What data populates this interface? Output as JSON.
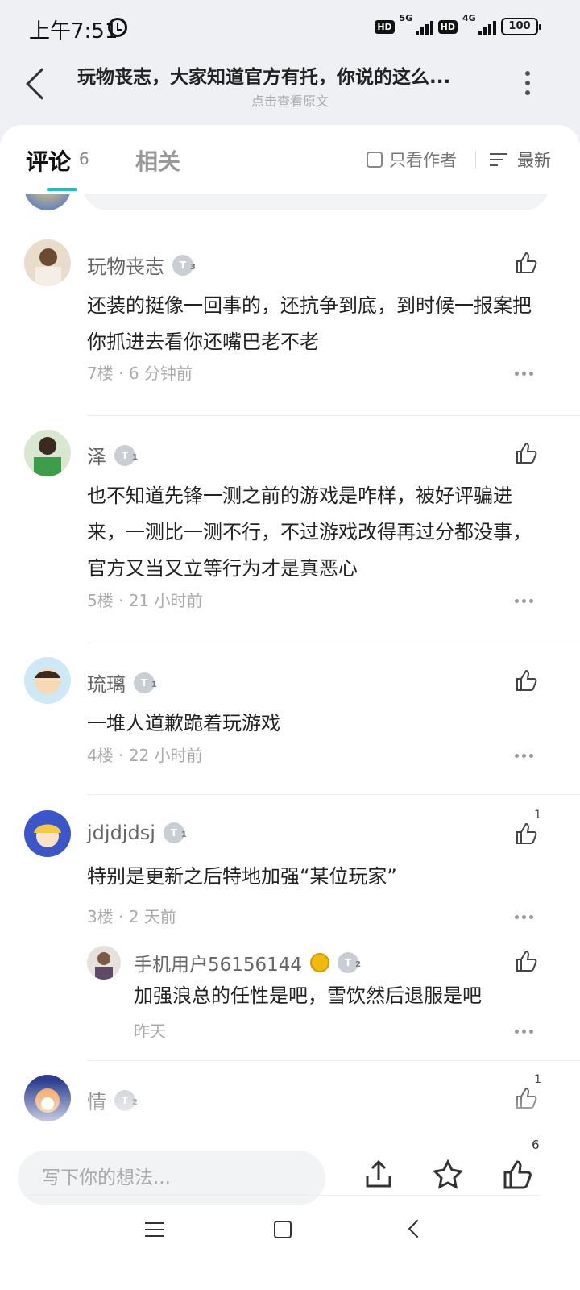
{
  "status": {
    "time": "上午7:51",
    "net1": "5G",
    "net2": "4G",
    "hd": "HD",
    "battery": "100"
  },
  "nav": {
    "title": "玩物丧志，大家知道官方有托，你说的这么...",
    "subtitle": "点击查看原文"
  },
  "tabs": {
    "comments": "评论",
    "comment_count": "6",
    "related": "相关",
    "author_only": "只看作者",
    "sort": "最新"
  },
  "comments": [
    {
      "name": "玩物丧志",
      "level": "3",
      "text": "还装的挺像一回事的，还抗争到底，到时候一报案把你抓进去看你还嘴巴老不老",
      "floor": "7楼",
      "time": "6 分钟前",
      "likes": ""
    },
    {
      "name": "泽",
      "level": "1",
      "text": "也不知道先锋一测之前的游戏是咋样，被好评骗进来，一测比一测不行，不过游戏改得再过分都没事，官方又当又立等行为才是真恶心",
      "floor": "5楼",
      "time": "21 小时前",
      "likes": ""
    },
    {
      "name": "琉璃",
      "level": "1",
      "text": "一堆人道歉跪着玩游戏",
      "floor": "4楼",
      "time": "22 小时前",
      "likes": ""
    },
    {
      "name": "jdjdjdsj",
      "level": "1",
      "text": "特别是更新之后特地加强“某位玩家”",
      "floor": "3楼",
      "time": "2 天前",
      "likes": "1"
    },
    {
      "name": "情",
      "level": "2",
      "likes": "1"
    }
  ],
  "reply": {
    "name": "手机用户56156144",
    "level": "2",
    "text": "加强浪总的任性是吧，雪饮然后退服是吧",
    "time": "昨天"
  },
  "meta_sep": "·",
  "bottom": {
    "input_placeholder": "写下你的想法...",
    "like_count": "6"
  },
  "colors": {
    "accent": "#17c3c8",
    "background": "#eef0f4"
  }
}
